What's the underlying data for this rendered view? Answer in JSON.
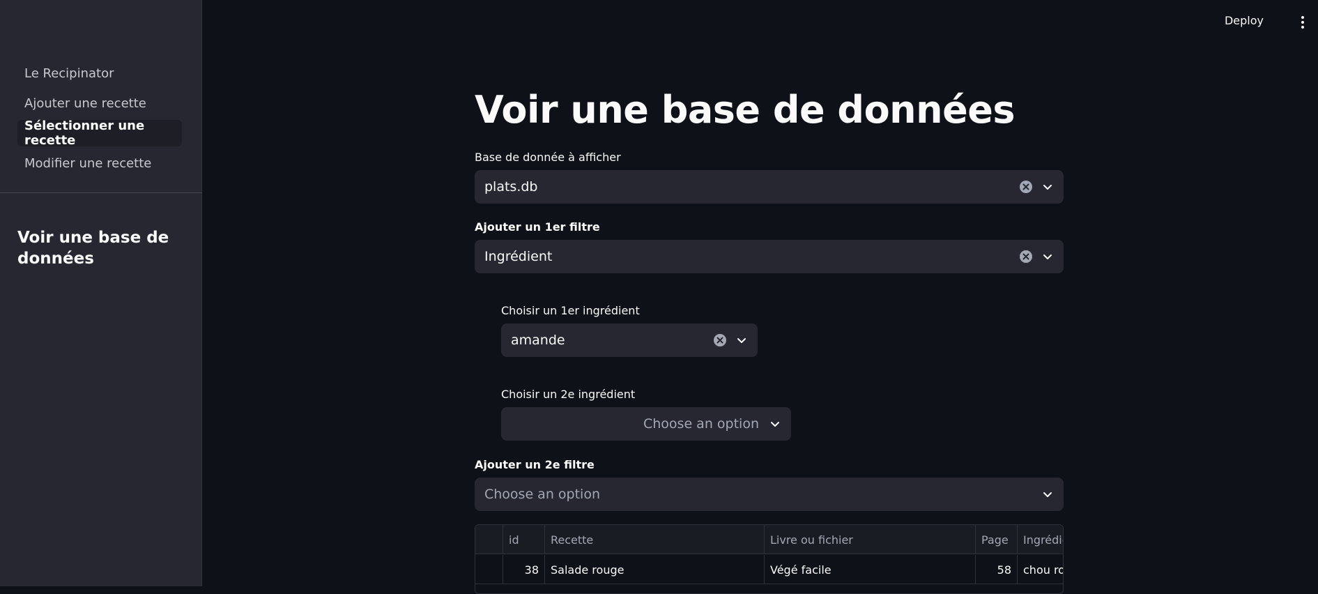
{
  "sidebar": {
    "items": [
      {
        "label": "Le Recipinator"
      },
      {
        "label": "Ajouter une recette"
      },
      {
        "label": "Sélectionner une recette"
      },
      {
        "label": "Modifier une recette"
      }
    ],
    "section_title": "Voir une base de données"
  },
  "toolbar": {
    "deploy_label": "Deploy",
    "menu_icon": "kebab-menu-icon"
  },
  "main": {
    "title": "Voir une base de données",
    "db_select": {
      "label": "Base de donnée à afficher",
      "value": "plats.db"
    },
    "filter1": {
      "label": "Ajouter un 1er filtre",
      "value": "Ingrédient"
    },
    "ingredient1": {
      "label": "Choisir un 1er ingrédient",
      "value": "amande"
    },
    "ingredient2": {
      "label": "Choisir un 2e ingrédient",
      "placeholder": "Choose an option"
    },
    "filter2": {
      "label": "Ajouter un 2e filtre",
      "placeholder": "Choose an option"
    }
  },
  "table": {
    "columns": [
      "",
      "id",
      "Recette",
      "Livre ou fichier",
      "Page",
      "Ingrédie"
    ],
    "rows": [
      [
        "",
        "38",
        "Salade rouge",
        "Végé facile",
        "58",
        "chou rou"
      ]
    ]
  },
  "colors": {
    "background": "#0e1117",
    "sidebar": "#262730",
    "input": "#262730"
  }
}
